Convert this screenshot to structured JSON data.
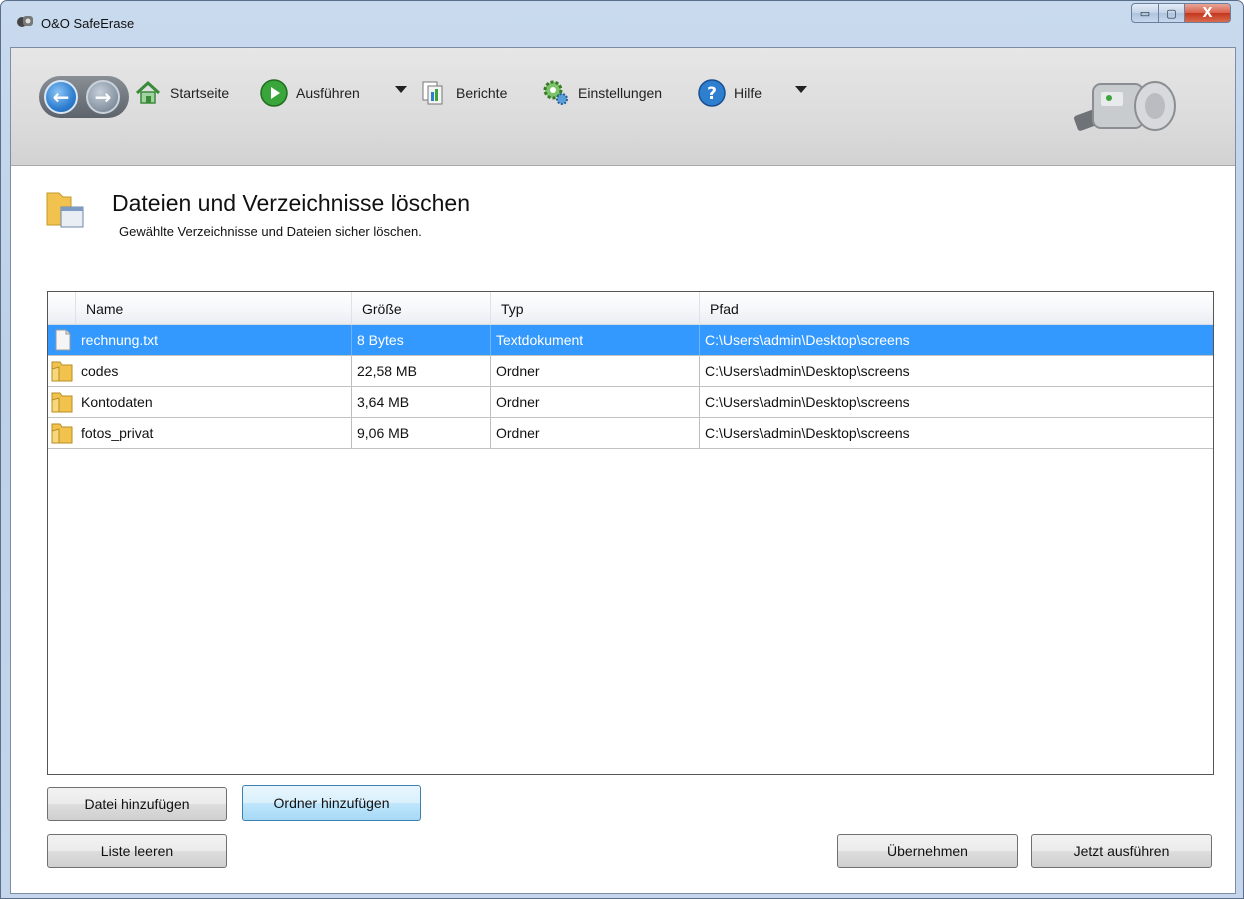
{
  "window": {
    "title": "O&O SafeErase",
    "controls": {
      "minimize": "▭",
      "maximize": "▢",
      "close": "X"
    }
  },
  "toolbar": {
    "items": [
      {
        "label": "Startseite",
        "icon": "home-icon"
      },
      {
        "label": "Ausführen",
        "icon": "play-icon",
        "dropdown": true
      },
      {
        "label": "Berichte",
        "icon": "reports-icon"
      },
      {
        "label": "Einstellungen",
        "icon": "gear-icon"
      },
      {
        "label": "Hilfe",
        "icon": "help-icon",
        "dropdown": true
      }
    ]
  },
  "page": {
    "title": "Dateien und Verzeichnisse löschen",
    "subtitle": "Gewählte Verzeichnisse und Dateien sicher löschen."
  },
  "list": {
    "columns": [
      "Name",
      "Größe",
      "Typ",
      "Pfad"
    ],
    "rows": [
      {
        "name": "rechnung.txt",
        "size": "8 Bytes",
        "type": "Textdokument",
        "path": "C:\\Users\\admin\\Desktop\\screens",
        "icon": "text-file-icon",
        "selected": true
      },
      {
        "name": "codes",
        "size": "22,58 MB",
        "type": "Ordner",
        "path": "C:\\Users\\admin\\Desktop\\screens",
        "icon": "folder-icon",
        "selected": false
      },
      {
        "name": "Kontodaten",
        "size": "3,64 MB",
        "type": "Ordner",
        "path": "C:\\Users\\admin\\Desktop\\screens",
        "icon": "folder-icon",
        "selected": false
      },
      {
        "name": "fotos_privat",
        "size": "9,06 MB",
        "type": "Ordner",
        "path": "C:\\Users\\admin\\Desktop\\screens",
        "icon": "folder-icon",
        "selected": false
      }
    ]
  },
  "buttons": {
    "add_file": "Datei hinzufügen",
    "add_folder": "Ordner hinzufügen",
    "clear_list": "Liste leeren",
    "apply": "Übernehmen",
    "run_now": "Jetzt ausführen"
  },
  "colors": {
    "selection": "#3399ff",
    "accent_green": "#3aa53a",
    "accent_blue": "#2f7fd0"
  }
}
